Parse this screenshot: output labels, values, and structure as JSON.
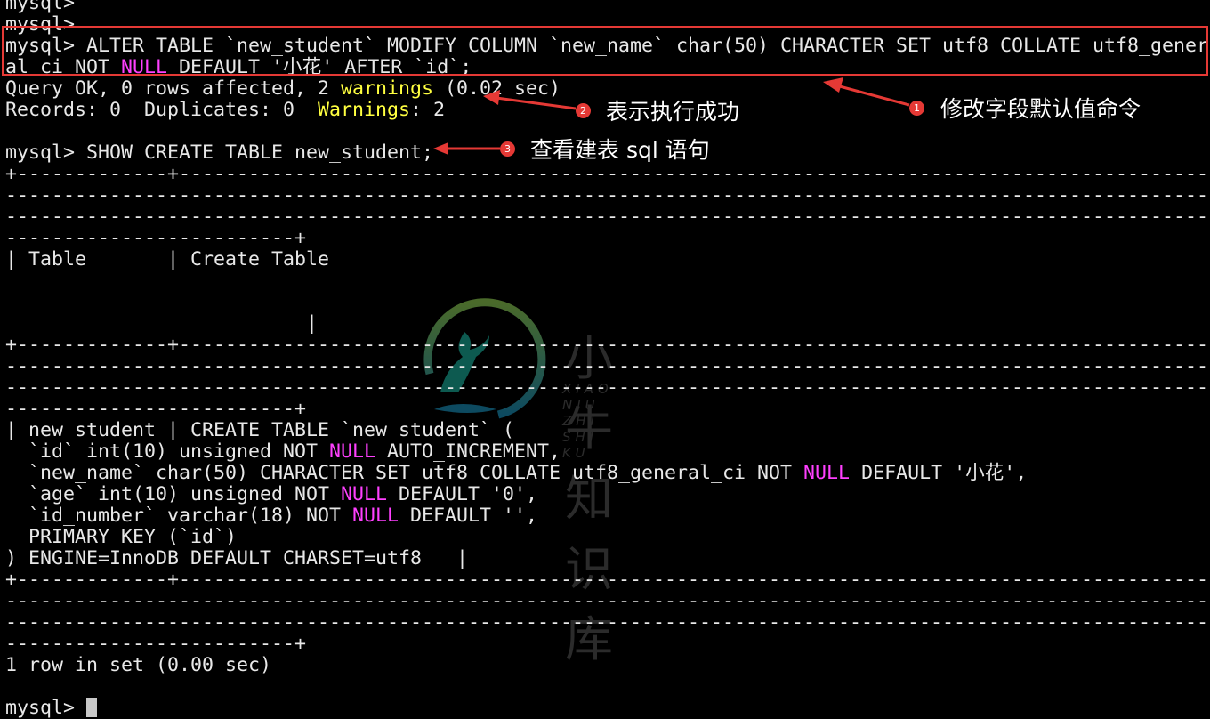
{
  "terminal": {
    "colors": {
      "text": "#e8e8e8",
      "null": "#ff40ff",
      "warning": "#ffff40",
      "background": "#000000"
    },
    "lines": [
      [
        {
          "t": "mysql>"
        }
      ],
      [
        {
          "t": "mysql>"
        }
      ],
      [
        {
          "t": "mysql> ALTER TABLE `new_student` MODIFY COLUMN `new_name` char(50) CHARACTER SET utf8 COLLATE utf8_gener"
        }
      ],
      [
        {
          "t": "al_ci NOT "
        },
        {
          "t": "NULL",
          "c": "null"
        },
        {
          "t": " DEFAULT '小花' AFTER `id`;"
        }
      ],
      [
        {
          "t": "Query OK, 0 rows affected, 2 "
        },
        {
          "t": "warnings",
          "c": "warning"
        },
        {
          "t": " (0.02 sec)"
        }
      ],
      [
        {
          "t": "Records: 0  Duplicates: 0  "
        },
        {
          "t": "Warnings",
          "c": "warning"
        },
        {
          "t": ": 2"
        }
      ],
      [],
      [
        {
          "t": "mysql> SHOW CREATE TABLE new_student;"
        }
      ],
      [
        {
          "t": "+-------------+------------------------------------------------------------------------------------------"
        }
      ],
      [
        {
          "t": "--------------------------------------------------------------------------------------------------------"
        }
      ],
      [
        {
          "t": "--------------------------------------------------------------------------------------------------------"
        }
      ],
      [
        {
          "t": "-------------------------+"
        }
      ],
      [
        {
          "t": "| Table       | Create Table"
        }
      ],
      [],
      [],
      [
        {
          "t": "                          |"
        }
      ],
      [
        {
          "t": "+-------------+------------------------------------------------------------------------------------------"
        }
      ],
      [
        {
          "t": "--------------------------------------------------------------------------------------------------------"
        }
      ],
      [
        {
          "t": "--------------------------------------------------------------------------------------------------------"
        }
      ],
      [
        {
          "t": "-------------------------+"
        }
      ],
      [
        {
          "t": "| new_student | CREATE TABLE `new_student` ("
        }
      ],
      [
        {
          "t": "  `id` int(10) unsigned NOT "
        },
        {
          "t": "NULL",
          "c": "null"
        },
        {
          "t": " AUTO_INCREMENT,"
        }
      ],
      [
        {
          "t": "  `new_name` char(50) CHARACTER SET utf8 COLLATE utf8_general_ci NOT "
        },
        {
          "t": "NULL",
          "c": "null"
        },
        {
          "t": " DEFAULT '小花',"
        }
      ],
      [
        {
          "t": "  `age` int(10) unsigned NOT "
        },
        {
          "t": "NULL",
          "c": "null"
        },
        {
          "t": " DEFAULT '0',"
        }
      ],
      [
        {
          "t": "  `id_number` varchar(18) NOT "
        },
        {
          "t": "NULL",
          "c": "null"
        },
        {
          "t": " DEFAULT '',"
        }
      ],
      [
        {
          "t": "  PRIMARY KEY (`id`)"
        }
      ],
      [
        {
          "t": ") ENGINE=InnoDB DEFAULT CHARSET=utf8   |"
        }
      ],
      [
        {
          "t": "+-------------+------------------------------------------------------------------------------------------"
        }
      ],
      [
        {
          "t": "--------------------------------------------------------------------------------------------------------"
        }
      ],
      [
        {
          "t": "--------------------------------------------------------------------------------------------------------"
        }
      ],
      [
        {
          "t": "-------------------------+"
        }
      ],
      [
        {
          "t": "1 row in set (0.00 sec)"
        }
      ],
      [],
      [
        {
          "t": "mysql> "
        }
      ]
    ]
  },
  "annotations": [
    {
      "num": "1",
      "label": "修改字段默认值命令"
    },
    {
      "num": "2",
      "label": "表示执行成功"
    },
    {
      "num": "3",
      "label": "查看建表 sql 语句"
    }
  ],
  "annotation_color": "#e53935",
  "watermark": {
    "title": "小牛知识库",
    "subtitle": "XIAO NIU ZHI SHI KU"
  }
}
